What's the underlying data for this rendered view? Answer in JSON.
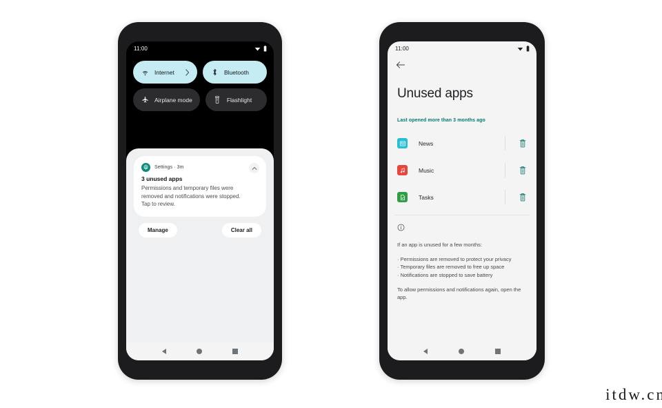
{
  "watermark": {
    "text": "itdw.cn"
  },
  "colors": {
    "tile_active_bg": "#c5ecf2",
    "tile_inactive_bg": "#2c2c2e",
    "accent_teal": "#00796b",
    "settings_badge": "#0b8b7a",
    "news_icon": "#24bfd4",
    "music_icon": "#e8453c",
    "tasks_icon": "#2f9e44",
    "shade_bg": "#eff0f1",
    "screen_light_bg": "#f4f4f4",
    "nav_icon": "#6f7478"
  },
  "left_phone": {
    "status_bar": {
      "time": "11:00",
      "icons": [
        "wifi-icon",
        "battery-icon"
      ]
    },
    "quick_settings": {
      "tiles": [
        {
          "label": "Internet",
          "icon": "wifi-icon",
          "state": "on",
          "has_chevron": true
        },
        {
          "label": "Bluetooth",
          "icon": "bluetooth-icon",
          "state": "on",
          "has_chevron": false
        },
        {
          "label": "Airplane mode",
          "icon": "airplane-icon",
          "state": "off",
          "has_chevron": false
        },
        {
          "label": "Flashlight",
          "icon": "flashlight-icon",
          "state": "off",
          "has_chevron": false
        }
      ]
    },
    "notification": {
      "app_line": "Settings · 3m",
      "title": "3 unused apps",
      "body": "Permissions and temporary files were removed and notifications were stopped. Tap to review.",
      "collapse_icon": "chevron-up-icon"
    },
    "shade_actions": {
      "manage": "Manage",
      "clear_all": "Clear all"
    },
    "nav_bar": {
      "back": "back-icon",
      "home": "home-icon",
      "recents": "recents-icon"
    }
  },
  "right_phone": {
    "status_bar": {
      "time": "11:00",
      "icons": [
        "wifi-icon",
        "battery-icon"
      ]
    },
    "back_icon": "arrow-left-icon",
    "page_title": "Unused apps",
    "section_label": "Last opened more than 3 months ago",
    "apps": [
      {
        "name": "News",
        "icon": "news-app-icon",
        "color": "#24bfd4",
        "action": "delete-icon"
      },
      {
        "name": "Music",
        "icon": "music-app-icon",
        "color": "#e8453c",
        "action": "delete-icon"
      },
      {
        "name": "Tasks",
        "icon": "tasks-app-icon",
        "color": "#2f9e44",
        "action": "delete-icon"
      }
    ],
    "info": {
      "icon": "info-icon",
      "intro": "If an app is unused for a few months:",
      "bullets": [
        "· Permissions are removed to protect your privacy",
        "· Temporary files are removed to free up space",
        "· Notifications are stopped to save battery"
      ],
      "footer": "To allow permissions and notifications again, open the app."
    },
    "nav_bar": {
      "back": "back-icon",
      "home": "home-icon",
      "recents": "recents-icon"
    }
  }
}
